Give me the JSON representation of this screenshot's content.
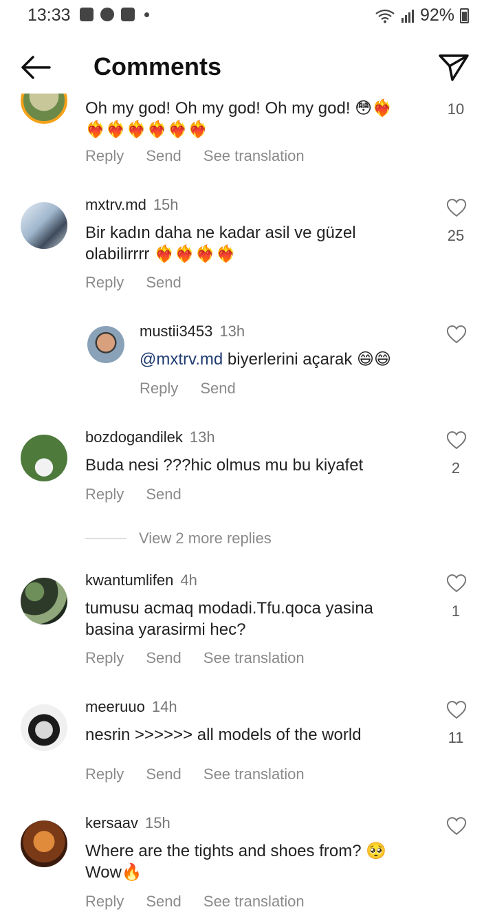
{
  "status": {
    "time": "13:33",
    "battery": "92%"
  },
  "header": {
    "title": "Comments"
  },
  "actions": {
    "reply": "Reply",
    "send": "Send",
    "translate": "See translation"
  },
  "comments": [
    {
      "username": "",
      "time": "",
      "text": "Oh my god! Oh my god! Oh my god!",
      "emoji": "😳❤️‍🔥 ❤️‍🔥❤️‍🔥❤️‍🔥❤️‍🔥❤️‍🔥❤️‍🔥",
      "likes": "10"
    },
    {
      "username": "mxtrv.md",
      "time": "15h",
      "text": "Bir kadın daha ne kadar asil ve güzel olabilirrrr",
      "emoji": "❤️‍🔥❤️‍🔥❤️‍🔥❤️‍🔥",
      "likes": "25"
    },
    {
      "username": "mustii3453",
      "time": "13h",
      "mention": "@mxtrv.md",
      "text": "biyerlerini açarak",
      "emoji": "😄😄",
      "likes": ""
    },
    {
      "username": "bozdogandilek",
      "time": "13h",
      "text": "Buda nesi ???hic olmus mu bu kiyafet",
      "likes": "2"
    },
    {
      "username": "kwantumlifen",
      "time": "4h",
      "text": "tumusu acmaq modadi.Tfu.qoca yasina basina yarasirmi hec?",
      "likes": "1"
    },
    {
      "username": "meeruuo",
      "time": "14h",
      "text": "nesrin >>>>>> all models of the world",
      "likes": "11"
    },
    {
      "username": "kersaav",
      "time": "15h",
      "text": "Where are the tights and shoes from?",
      "emoji": "🥺",
      "text2": "Wow",
      "emoji2": "🔥",
      "likes": ""
    }
  ],
  "view_more": "View 2 more replies",
  "colors": {
    "mention": "#1f3b70",
    "muted": "#8a8a8a",
    "text": "#222222"
  }
}
